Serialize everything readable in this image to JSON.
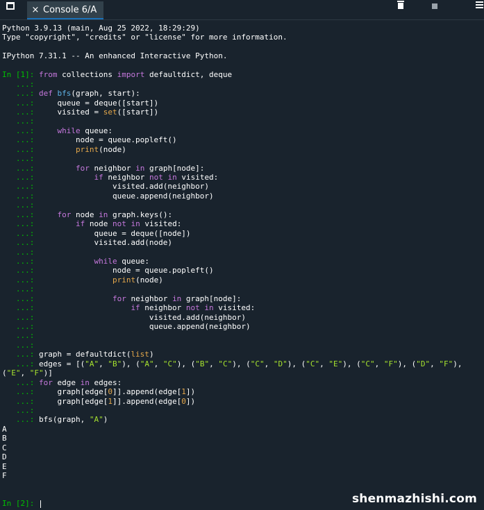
{
  "tabbar": {
    "tab_label": "Console 6/A",
    "close_glyph": "×"
  },
  "banner": {
    "line1": "Python 3.9.13 (main, Aug 25 2022, 18:29:29)",
    "line2": "Type \"copyright\", \"credits\" or \"license\" for more information.",
    "line3": "IPython 7.31.1 -- An enhanced Interactive Python."
  },
  "prompts": {
    "in1": "In [1]:",
    "cont": "   ...:",
    "in2": "In [2]:"
  },
  "code": {
    "l01": [
      [
        "kw",
        "from"
      ],
      [
        "t",
        " collections "
      ],
      [
        "kw",
        "import"
      ],
      [
        "t",
        " defaultdict, deque"
      ]
    ],
    "l02": [],
    "l03": [
      [
        "kw",
        "def"
      ],
      [
        "t",
        " "
      ],
      [
        "fn",
        "bfs"
      ],
      [
        "t",
        "(graph, start):"
      ]
    ],
    "l04": [
      [
        "t",
        "    queue = deque([start])"
      ]
    ],
    "l05": [
      [
        "t",
        "    visited = "
      ],
      [
        "bi",
        "set"
      ],
      [
        "t",
        "([start])"
      ]
    ],
    "l06": [],
    "l07": [
      [
        "t",
        "    "
      ],
      [
        "kw",
        "while"
      ],
      [
        "t",
        " queue:"
      ]
    ],
    "l08": [
      [
        "t",
        "        node = queue.popleft()"
      ]
    ],
    "l09": [
      [
        "t",
        "        "
      ],
      [
        "bi",
        "print"
      ],
      [
        "t",
        "(node)"
      ]
    ],
    "l10": [],
    "l11": [
      [
        "t",
        "        "
      ],
      [
        "kw",
        "for"
      ],
      [
        "t",
        " neighbor "
      ],
      [
        "kw",
        "in"
      ],
      [
        "t",
        " graph[node]:"
      ]
    ],
    "l12": [
      [
        "t",
        "            "
      ],
      [
        "kw",
        "if"
      ],
      [
        "t",
        " neighbor "
      ],
      [
        "kw",
        "not in"
      ],
      [
        "t",
        " visited:"
      ]
    ],
    "l13": [
      [
        "t",
        "                visited.add(neighbor)"
      ]
    ],
    "l14": [
      [
        "t",
        "                queue.append(neighbor)"
      ]
    ],
    "l15": [],
    "l16": [
      [
        "t",
        "    "
      ],
      [
        "kw",
        "for"
      ],
      [
        "t",
        " node "
      ],
      [
        "kw",
        "in"
      ],
      [
        "t",
        " graph.keys():"
      ]
    ],
    "l17": [
      [
        "t",
        "        "
      ],
      [
        "kw",
        "if"
      ],
      [
        "t",
        " node "
      ],
      [
        "kw",
        "not in"
      ],
      [
        "t",
        " visited:"
      ]
    ],
    "l18": [
      [
        "t",
        "            queue = deque([node])"
      ]
    ],
    "l19": [
      [
        "t",
        "            visited.add(node)"
      ]
    ],
    "l20": [],
    "l21": [
      [
        "t",
        "            "
      ],
      [
        "kw",
        "while"
      ],
      [
        "t",
        " queue:"
      ]
    ],
    "l22": [
      [
        "t",
        "                node = queue.popleft()"
      ]
    ],
    "l23": [
      [
        "t",
        "                "
      ],
      [
        "bi",
        "print"
      ],
      [
        "t",
        "(node)"
      ]
    ],
    "l24": [],
    "l25": [
      [
        "t",
        "                "
      ],
      [
        "kw",
        "for"
      ],
      [
        "t",
        " neighbor "
      ],
      [
        "kw",
        "in"
      ],
      [
        "t",
        " graph[node]:"
      ]
    ],
    "l26": [
      [
        "t",
        "                    "
      ],
      [
        "kw",
        "if"
      ],
      [
        "t",
        " neighbor "
      ],
      [
        "kw",
        "not in"
      ],
      [
        "t",
        " visited:"
      ]
    ],
    "l27": [
      [
        "t",
        "                        visited.add(neighbor)"
      ]
    ],
    "l28": [
      [
        "t",
        "                        queue.append(neighbor)"
      ]
    ],
    "l29": [],
    "l30": [],
    "l31": [
      [
        "t",
        "graph = defaultdict("
      ],
      [
        "bi",
        "list"
      ],
      [
        "t",
        ")"
      ]
    ],
    "l32": [
      [
        "t",
        "edges = [("
      ],
      [
        "str",
        "\"A\""
      ],
      [
        "t",
        ", "
      ],
      [
        "str",
        "\"B\""
      ],
      [
        "t",
        "), ("
      ],
      [
        "str",
        "\"A\""
      ],
      [
        "t",
        ", "
      ],
      [
        "str",
        "\"C\""
      ],
      [
        "t",
        "), ("
      ],
      [
        "str",
        "\"B\""
      ],
      [
        "t",
        ", "
      ],
      [
        "str",
        "\"C\""
      ],
      [
        "t",
        "), ("
      ],
      [
        "str",
        "\"C\""
      ],
      [
        "t",
        ", "
      ],
      [
        "str",
        "\"D\""
      ],
      [
        "t",
        "), ("
      ],
      [
        "str",
        "\"C\""
      ],
      [
        "t",
        ", "
      ],
      [
        "str",
        "\"E\""
      ],
      [
        "t",
        "), ("
      ],
      [
        "str",
        "\"C\""
      ],
      [
        "t",
        ", "
      ],
      [
        "str",
        "\"F\""
      ],
      [
        "t",
        "), ("
      ],
      [
        "str",
        "\"D\""
      ],
      [
        "t",
        ", "
      ],
      [
        "str",
        "\"F\""
      ],
      [
        "t",
        "),"
      ]
    ],
    "l32b": [
      [
        "t",
        "("
      ],
      [
        "str",
        "\"E\""
      ],
      [
        "t",
        ", "
      ],
      [
        "str",
        "\"F\""
      ],
      [
        "t",
        ")]"
      ]
    ],
    "l33": [
      [
        "kw",
        "for"
      ],
      [
        "t",
        " edge "
      ],
      [
        "kw",
        "in"
      ],
      [
        "t",
        " edges:"
      ]
    ],
    "l34": [
      [
        "t",
        "    graph[edge["
      ],
      [
        "num",
        "0"
      ],
      [
        "t",
        "]].append(edge["
      ],
      [
        "num",
        "1"
      ],
      [
        "t",
        "])"
      ]
    ],
    "l35": [
      [
        "t",
        "    graph[edge["
      ],
      [
        "num",
        "1"
      ],
      [
        "t",
        "]].append(edge["
      ],
      [
        "num",
        "0"
      ],
      [
        "t",
        "])"
      ]
    ],
    "l36": [],
    "l37": [
      [
        "t",
        "bfs(graph, "
      ],
      [
        "str",
        "\"A\""
      ],
      [
        "t",
        ")"
      ]
    ]
  },
  "output": [
    "A",
    "B",
    "C",
    "D",
    "E",
    "F"
  ],
  "watermark": "shenmazhishi.com"
}
